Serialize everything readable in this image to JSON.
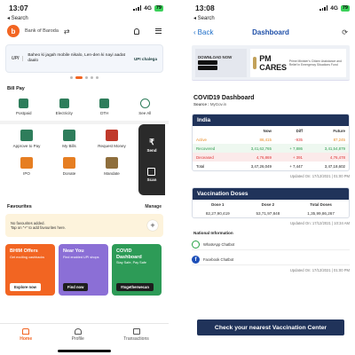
{
  "left": {
    "status": {
      "time": "13:07",
      "network": "4G",
      "battery": "79"
    },
    "back_label": "◂ Search",
    "bank_name": "Bank of Baroda",
    "banner": {
      "mark": "UPI",
      "text": "Baheo ki jagah mobile nikalo, Len-den ki nayi aadat daalo",
      "cta": "UPI chalega"
    },
    "bill_pay": {
      "title": "Bill Pay",
      "items": [
        {
          "label": "Postpaid"
        },
        {
          "label": "Electricity"
        },
        {
          "label": "DTH"
        },
        {
          "label": "See All"
        }
      ]
    },
    "grid": [
      {
        "label": "Approve to Pay",
        "color": "#2e7d5b"
      },
      {
        "label": "My Bills",
        "color": "#2e7d5b"
      },
      {
        "label": "Request Money",
        "color": "#c0392b"
      },
      {
        "label": "IPO",
        "color": "#e67e22"
      },
      {
        "label": "Donate",
        "color": "#e67e22"
      },
      {
        "label": "Mandate",
        "color": "#8e6e3c"
      }
    ],
    "side_actions": {
      "send": "Send",
      "scan": "Scan",
      "send_glyph": "₹"
    },
    "favourites": {
      "title": "Favourites",
      "manage": "Manage",
      "empty_text": "No favourites added.\nTap on \"+\" to add favourites here.",
      "plus": "+"
    },
    "cards": [
      {
        "title": "BHIM Offers",
        "sub": "Get exciting cashbacks",
        "btn": "Explore now",
        "color": "#f26522"
      },
      {
        "title": "Near You",
        "sub": "Find enabled UPI shops",
        "btn": "Find now",
        "color": "#8b6fd6"
      },
      {
        "title": "COVID Dashboard",
        "sub": "Stay Safe, Pay Safe",
        "btn": "#togetherwecan",
        "color": "#2d9b57"
      }
    ],
    "tabs": [
      {
        "label": "Home",
        "active": true
      },
      {
        "label": "Profile",
        "active": false
      },
      {
        "label": "Transactions",
        "active": false
      }
    ]
  },
  "right": {
    "status": {
      "time": "13:08",
      "network": "4G",
      "battery": "79"
    },
    "back_label": "◂ Search",
    "nav": {
      "back": "Back",
      "title": "Dashboard"
    },
    "banner": {
      "download": "DOWNLOAD NOW",
      "brand": "PM CARES",
      "brand_sub": "Prime Minister's Citizen Assistance and Relief in Emergency Situations Fund"
    },
    "dashboard": {
      "title": "COVID19 Dashboard",
      "source_label": "Source :",
      "source": "MyGov.in"
    },
    "india": {
      "title": "India",
      "headers": [
        "",
        "Now",
        "Diff",
        "Future"
      ],
      "rows": [
        {
          "label": "Active",
          "now": "86,415",
          "diff": "-935",
          "future": "87,245"
        },
        {
          "label": "Recovered",
          "now": "3,41,62,765",
          "diff": "+ 7,886",
          "future": "3,41,54,879"
        },
        {
          "label": "Deceased",
          "now": "4,76,869",
          "diff": "+ 391",
          "future": "4,76,478"
        },
        {
          "label": "Total",
          "now": "3,47,26,049",
          "diff": "+ 7,447",
          "future": "3,47,18,602"
        }
      ],
      "updated": "Updated On: 17/12/2021 | 01:00 PM"
    },
    "vaccination": {
      "title": "Vaccination Doses",
      "headers": [
        "Dose 1",
        "Dose 2",
        "Total Doses"
      ],
      "values": [
        "82,27,90,419",
        "53,71,97,848",
        "1,35,99,86,267"
      ],
      "updated": "Updated On: 17/12/2021 | 10:34 AM"
    },
    "national": {
      "title": "National Information",
      "items": [
        {
          "label": "WhatsApp Chatbot"
        },
        {
          "label": "Facebook Chatbot"
        }
      ],
      "updated": "Updated On: 17/12/2021 | 01:00 PM"
    },
    "cta": "Check your nearest Vaccination Center"
  }
}
